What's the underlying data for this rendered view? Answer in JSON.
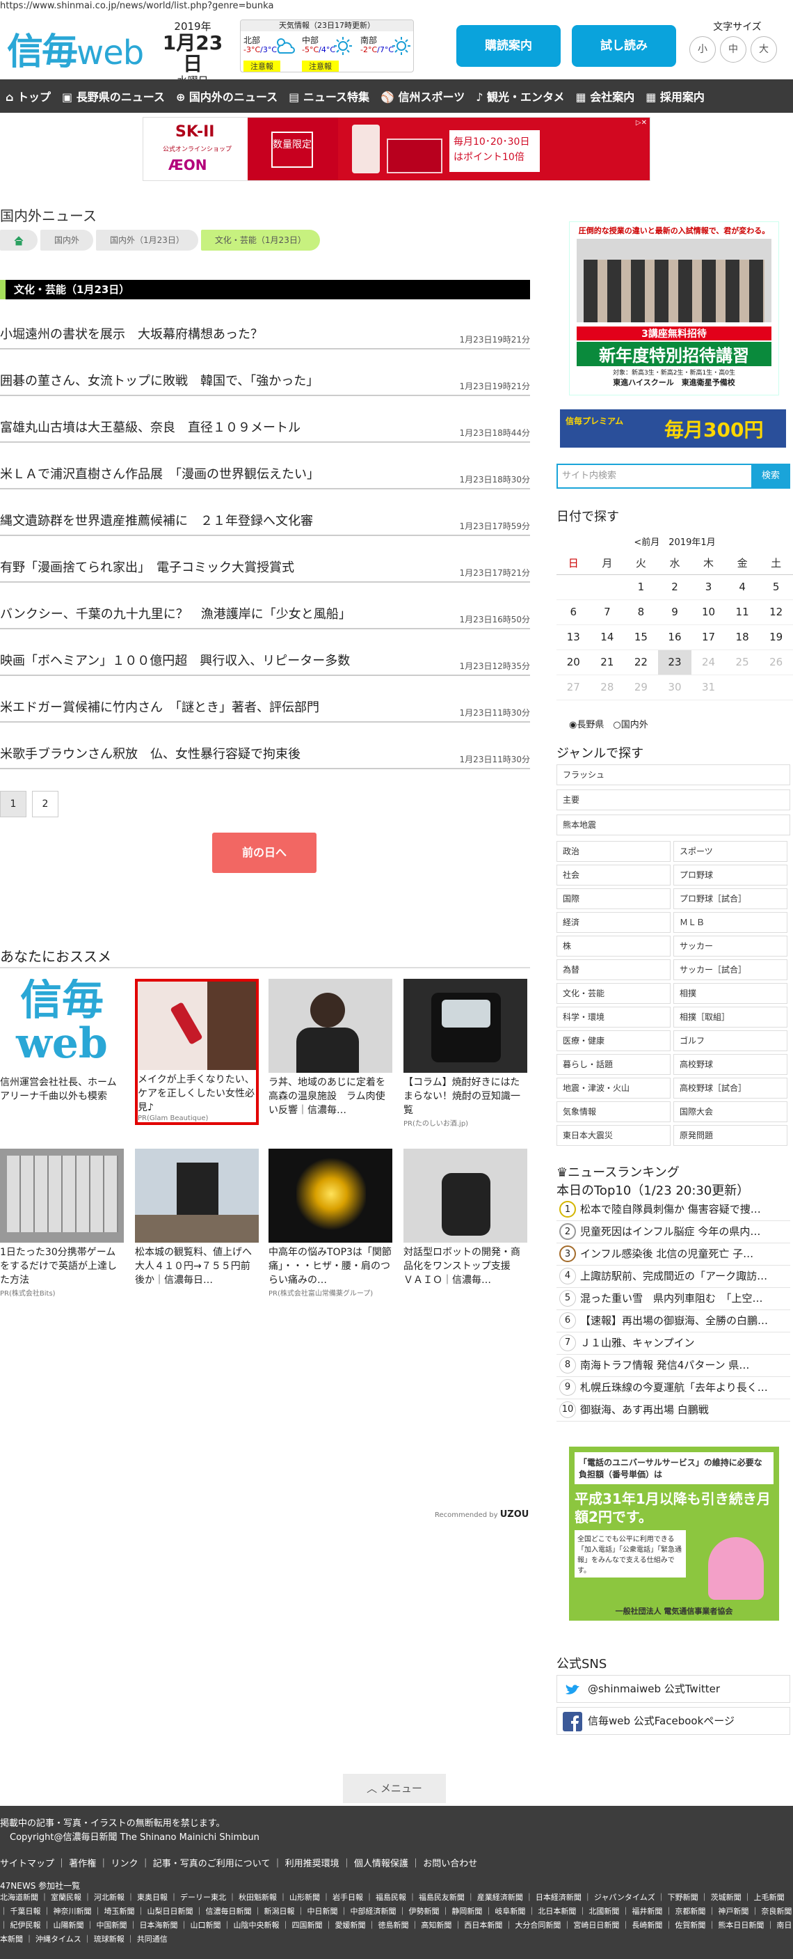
{
  "url": "https://www.shinmai.co.jp/news/world/list.php?genre=bunka",
  "header": {
    "logo_main": "信毎",
    "logo_web": "web",
    "year": "2019年",
    "month_day": "1月23日",
    "weekday": "水曜日",
    "weather_title": "天気情報（23日17時更新）",
    "weather": [
      {
        "area": "北部",
        "high": "-3°C",
        "low": "/3°C",
        "icon": "snow-cloud-icon",
        "warning": "注意報"
      },
      {
        "area": "中部",
        "high": "-5°C",
        "low": "/4°C",
        "icon": "sun-icon",
        "warning": "注意報"
      },
      {
        "area": "南部",
        "high": "-2°C",
        "low": "/7°C",
        "icon": "sun-icon",
        "warning": ""
      }
    ],
    "delivery_button": "購読案内",
    "trial_button": "試し読み",
    "font_size_label": "文字サイズ",
    "font_sizes": [
      "小",
      "中",
      "大"
    ]
  },
  "nav": [
    "トップ",
    "長野県のニュース",
    "国内外のニュース",
    "ニュース特集",
    "信州スポーツ",
    "観光・エンタメ",
    "会社案内",
    "採用案内"
  ],
  "ad_banner": {
    "brand": "SK-II",
    "brand_sub": "公式オンラインショップ",
    "store": "ÆON",
    "badge": "数量限定",
    "text": "毎月10･20･30日はポイント10倍"
  },
  "page_title": "国内外ニュース",
  "breadcrumbs": [
    "国内外",
    "国内外（1月23日）",
    "文化・芸能（1月23日）"
  ],
  "section_title": "文化・芸能（1月23日）",
  "articles": [
    {
      "title": "小堀遠州の書状を展示　大坂幕府構想あった？",
      "time": "1月23日19時21分"
    },
    {
      "title": "囲碁の菫さん、女流トップに敗戦　韓国で、「強かった」",
      "time": "1月23日19時21分"
    },
    {
      "title": "富雄丸山古墳は大王墓級、奈良　直径１０９メートル",
      "time": "1月23日18時44分"
    },
    {
      "title": "米ＬＡで浦沢直樹さん作品展　「漫画の世界観伝えたい」",
      "time": "1月23日18時30分"
    },
    {
      "title": "縄文遺跡群を世界遺産推薦候補に　２１年登録へ文化審",
      "time": "1月23日17時59分"
    },
    {
      "title": "有野「漫画捨てられ家出」　電子コミック大賞授賞式",
      "time": "1月23日17時21分"
    },
    {
      "title": "バンクシー、千葉の九十九里に？　漁港護岸に「少女と風船」",
      "time": "1月23日16時50分"
    },
    {
      "title": "映画「ボヘミアン」１００億円超　興行収入、リピーター多数",
      "time": "1月23日12時35分"
    },
    {
      "title": "米エドガー賞候補に竹内さん　「謎とき」著者、評伝部門",
      "time": "1月23日11時30分"
    },
    {
      "title": "米歌手ブラウンさん釈放　仏、女性暴行容疑で拘束後",
      "time": "1月23日11時30分"
    }
  ],
  "pagination": [
    "1",
    "2"
  ],
  "prev_day": "前の日へ",
  "recommend": {
    "title": "あなたにおススメ",
    "cards": [
      {
        "caption": "信州運営会社社長、ホームアリーナ千曲以外も模索",
        "pr": ""
      },
      {
        "caption": "メイクが上手くなりたい、ケアを正しくしたい女性必見♪",
        "pr": "PR(Glam Beautique)"
      },
      {
        "caption": "ラ丼、地域のあじに定着を　高森の温泉施設　ラム肉使い反響｜信濃毎…",
        "pr": ""
      },
      {
        "caption": "【コラム】焼酎好きにはたまらない！焼酎の豆知識一覧",
        "pr": "PR(たのしいお酒.jp)"
      },
      {
        "caption": "1日たった30分携帯ゲームをするだけで英語が上達した方法",
        "pr": "PR(株式会社Bits)"
      },
      {
        "caption": "松本城の観覧料、値上げへ　大人４１０円→７５５円前後か｜信濃毎日…",
        "pr": ""
      },
      {
        "caption": "中高年の悩みTOP3は「関節痛」・・・ヒザ・腰・肩のつらい痛みの…",
        "pr": "PR(株式会社富山常備薬グループ)"
      },
      {
        "caption": "対話型ロボットの開発・商品化をワンストップ支援　ＶＡＩＯ｜信濃毎…",
        "pr": ""
      }
    ],
    "recommended_by": "Recommended by",
    "uzou": "UZOU"
  },
  "sidebar": {
    "ad1_text": "圧倒的な授業の違いと最新の入試情報で、君が変わる。",
    "ad1_banner": "3講座無料招待",
    "ad1_main": "新年度特別招待講習",
    "ad1_sub": "対象：新高3生・新高2生・新高1生・高0生",
    "ad1_school": "東進ハイスクール　東進衛星予備校",
    "ad2_left": "信毎プレミアム",
    "ad2_right": "毎月300円",
    "search_placeholder": "サイト内検索",
    "search_button": "検索",
    "date_title": "日付で探す",
    "cal_prev": "<前月",
    "cal_month": "2019年1月",
    "weekdays": [
      "日",
      "月",
      "火",
      "水",
      "木",
      "金",
      "土"
    ],
    "weeks": [
      [
        "",
        "",
        "1",
        "2",
        "3",
        "4",
        "5"
      ],
      [
        "6",
        "7",
        "8",
        "9",
        "10",
        "11",
        "12"
      ],
      [
        "13",
        "14",
        "15",
        "16",
        "17",
        "18",
        "19"
      ],
      [
        "20",
        "21",
        "22",
        "23",
        "24",
        "25",
        "26"
      ],
      [
        "27",
        "28",
        "29",
        "30",
        "31",
        "",
        ""
      ]
    ],
    "radio1": "長野県",
    "radio2": "国内外",
    "genre_title": "ジャンルで探す",
    "genres_full": [
      "フラッシュ",
      "主要",
      "熊本地震"
    ],
    "genres_pairs": [
      [
        "政治",
        "スポーツ"
      ],
      [
        "社会",
        "プロ野球"
      ],
      [
        "国際",
        "プロ野球［試合］"
      ],
      [
        "経済",
        "ＭＬＢ"
      ],
      [
        "株",
        "サッカー"
      ],
      [
        "為替",
        "サッカー［試合］"
      ],
      [
        "文化・芸能",
        "相撲"
      ],
      [
        "科学・環境",
        "相撲［取組］"
      ],
      [
        "医療・健康",
        "ゴルフ"
      ],
      [
        "暮らし・話題",
        "高校野球"
      ],
      [
        "地震・津波・火山",
        "高校野球［試合］"
      ],
      [
        "気象情報",
        "国際大会"
      ],
      [
        "東日本大震災",
        "原発問題"
      ]
    ],
    "ranking_title": "ニュースランキング",
    "ranking_sub": "本日のTop10（1/23 20:30更新）",
    "ranking": [
      "松本で陸自隊員刺傷か 傷害容疑で捜…",
      "児童死因はインフル脳症 今年の県内…",
      "インフル感染後 北信の児童死亡 子…",
      "上諏訪駅前、完成間近の「アーク諏訪…",
      "混った重い雪　県内列車阻む　「上空…",
      "【速報】再出場の御嶽海、全勝の白鵬…",
      "Ｊ１山雅、キャンプイン",
      "南海トラフ情報 発信4パターン 県…",
      "札幌丘珠線の今夏運航「去年より長く…",
      "御嶽海、あす再出場 白鵬戦"
    ],
    "ad3_top": "「電話のユニバーサルサービス」の維持に必要な負担額（番号単価）は",
    "ad3_main": "平成31年1月以降も引き続き月額2円です。",
    "ad3_sub": "全国どこでも公平に利用できる「加入電話」「公衆電話」「緊急通報」をみんなで支える仕組みです。",
    "ad3_org": "一般社団法人 電気通信事業者協会",
    "sns_title": "公式SNS",
    "twitter": "@shinmaiweb 公式Twitter",
    "facebook": "信毎web 公式Facebookページ"
  },
  "menu_button": "メニュー",
  "footer": {
    "notice": "掲載中の記事・写真・イラストの無断転用を禁じます。",
    "copyright": "Copyright@信濃毎日新聞 The Shinano Mainichi Shimbun",
    "links": "サイトマップ ｜ 著作権 ｜ リンク ｜ 記事・写真のご利用について ｜ 利用推奨環境 ｜ 個人情報保護 ｜ お問い合わせ",
    "news47_title": "47NEWS 参加社一覧",
    "news47": "北海道新聞 ｜ 室蘭民報 ｜ 河北新報 ｜ 東奥日報 ｜ デーリー東北 ｜ 秋田魁新報 ｜ 山形新聞 ｜ 岩手日報 ｜ 福島民報 ｜ 福島民友新聞 ｜ 産業経済新聞 ｜ 日本経済新聞 ｜ ジャパンタイムズ ｜ 下野新聞 ｜ 茨城新聞 ｜ 上毛新聞 ｜ 千葉日報 ｜ 神奈川新聞 ｜ 埼玉新聞 ｜ 山梨日日新聞 ｜ 信濃毎日新聞 ｜ 新潟日報 ｜ 中日新聞 ｜ 中部経済新聞 ｜ 伊勢新聞 ｜ 静岡新聞 ｜ 岐阜新聞 ｜ 北日本新聞 ｜ 北國新聞 ｜ 福井新聞 ｜ 京都新聞 ｜ 神戸新聞 ｜ 奈良新聞 ｜ 紀伊民報 ｜ 山陽新聞 ｜ 中国新聞 ｜ 日本海新聞 ｜ 山口新聞 ｜ 山陰中央新報 ｜ 四国新聞 ｜ 愛媛新聞 ｜ 徳島新聞 ｜ 高知新聞 ｜ 西日本新聞 ｜ 大分合同新聞 ｜ 宮崎日日新聞 ｜ 長崎新聞 ｜ 佐賀新聞 ｜ 熊本日日新聞 ｜ 南日本新聞 ｜ 沖縄タイムス ｜ 琉球新報 ｜ 共同通信"
  }
}
